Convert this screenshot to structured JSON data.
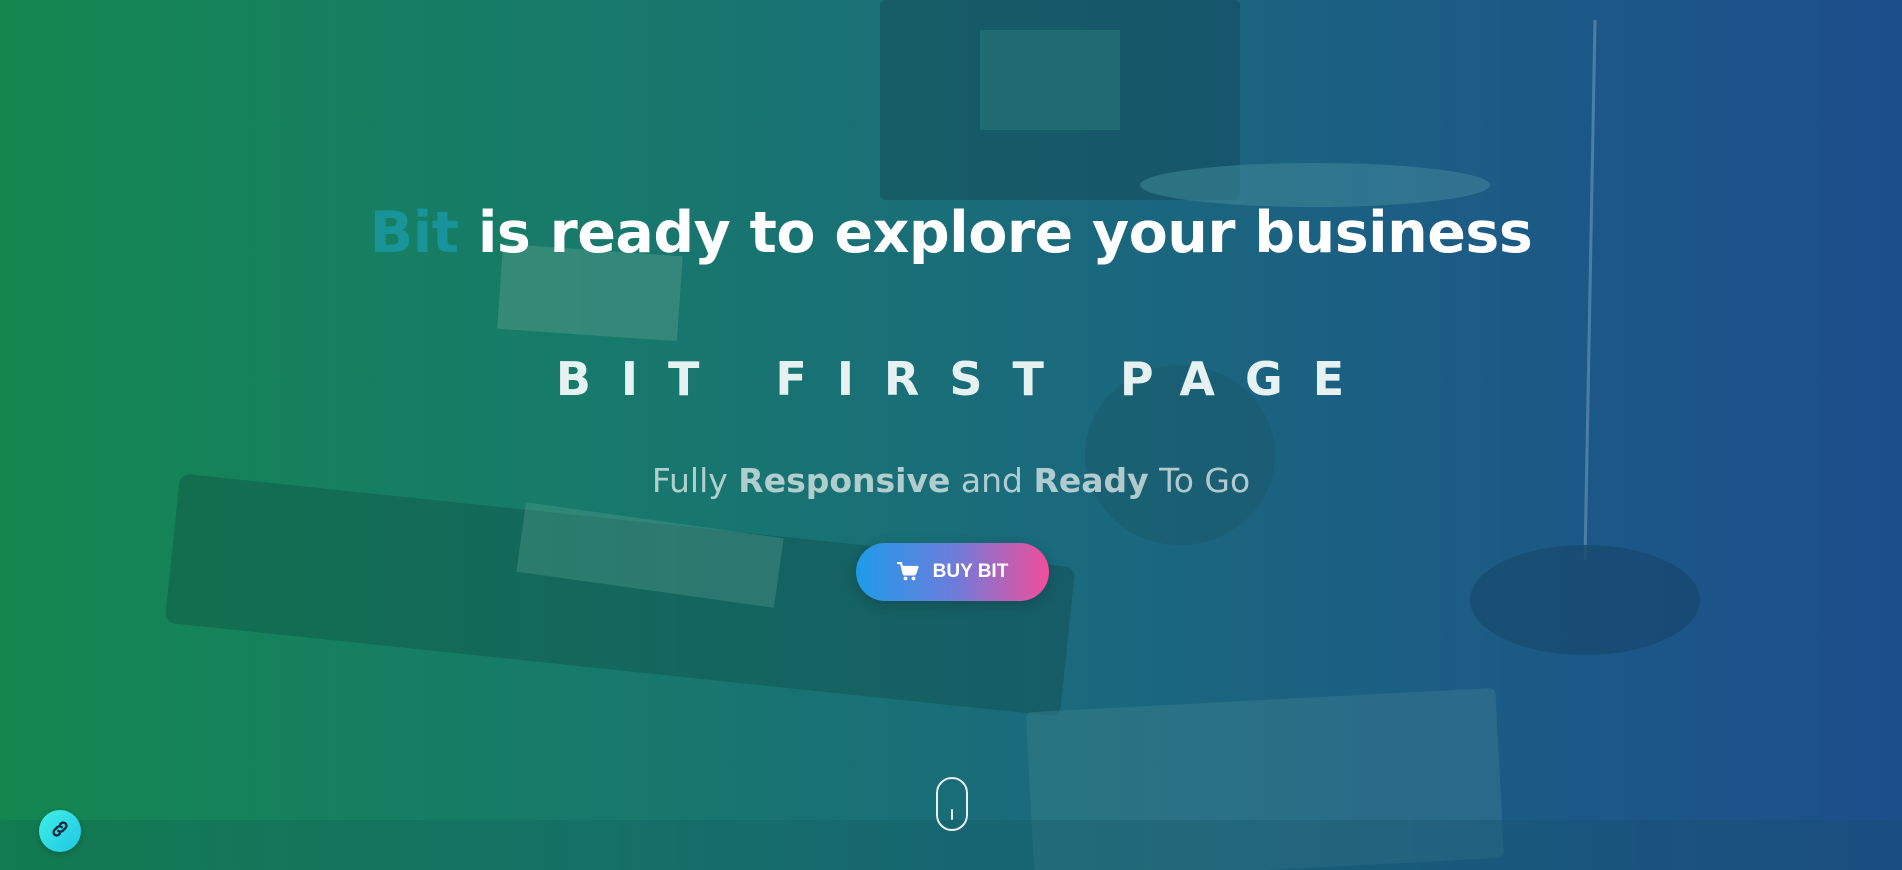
{
  "hero": {
    "headline_brand": "Bit",
    "headline_rest": " is ready to explore your business",
    "subtitle": "BIT FIRST PAGE",
    "tagline": {
      "part1": "Fully ",
      "part2": "Responsive",
      "part3": " and ",
      "part4": "Ready",
      "part5": " To Go"
    },
    "cta_label": "BUY BIT",
    "cta_icon": "cart-icon"
  },
  "scroll_indicator": {
    "icon": "mouse-scroll-icon"
  },
  "floating_button": {
    "icon": "link-icon"
  },
  "colors": {
    "gradient_left": "#14874f",
    "gradient_right": "#1d4e8c",
    "brand_accent": "#1aa6c8",
    "cta_start": "#1f9be8",
    "cta_end": "#f04e9a",
    "fab": "#3ff0e6"
  }
}
